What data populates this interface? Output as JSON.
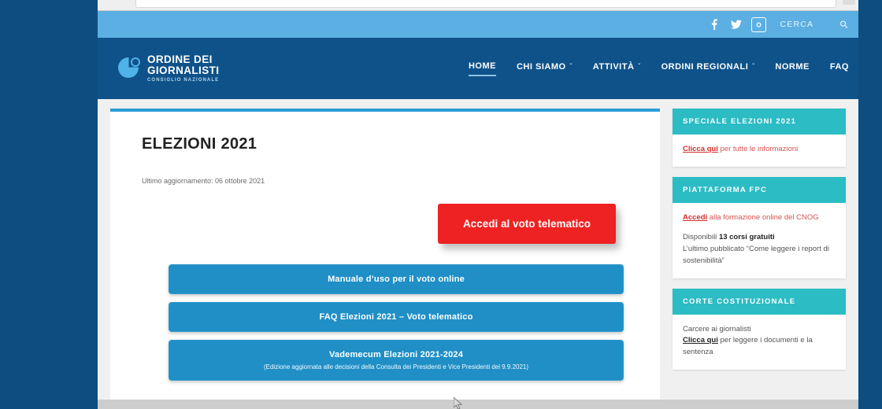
{
  "browser": {
    "urlbar_value": ""
  },
  "topbar": {
    "social": [
      {
        "name": "facebook-icon",
        "glyph": "f"
      },
      {
        "name": "twitter-icon",
        "glyph": "t"
      },
      {
        "name": "instagram-icon",
        "glyph": "▣"
      }
    ],
    "search_label": "CERCA",
    "search_icon": "search-icon"
  },
  "header": {
    "logo": {
      "line1": "ORDINE DEI",
      "line2": "GIORNALISTI",
      "line3": "CONSIGLIO NAZIONALE"
    },
    "menu": [
      {
        "label": "HOME",
        "caret": "",
        "active": true
      },
      {
        "label": "CHI SIAMO",
        "caret": "ˇ",
        "active": false
      },
      {
        "label": "ATTIVITÀ",
        "caret": "ˇ",
        "active": false
      },
      {
        "label": "ORDINI REGIONALI",
        "caret": "ˇ",
        "active": false
      },
      {
        "label": "NORME",
        "caret": "",
        "active": false
      },
      {
        "label": "FAQ",
        "caret": "",
        "active": false
      }
    ]
  },
  "article": {
    "title": "ELEZIONI 2021",
    "updated": "Ultimo aggiornamento: 06 ottobre 2021",
    "primary_button": "Accedi al voto telematico",
    "buttons": [
      {
        "title": "Manuale d’uso per il voto online",
        "subtitle": ""
      },
      {
        "title": "FAQ Elezioni 2021 – Voto telematico",
        "subtitle": ""
      },
      {
        "title": "Vademecum Elezioni 2021-2024",
        "subtitle": "(Edizione aggiornata alle decisioni della Consulta dei Presidenti e Vice Presidenti del 9.9.2021)"
      }
    ]
  },
  "sidebar": {
    "widgets": [
      {
        "heading": "SPECIALE ELEZIONI 2021",
        "link_text": "Clicca qui",
        "line_rest": " per tutte le informazioni"
      },
      {
        "heading": "PIATTAFORMA FPC",
        "link_text": "Accedi",
        "line_rest": " alla formazione online del CNOG",
        "stat_prefix": "Disponibili ",
        "stat_bold": "13 corsi gratuiti",
        "stat_suffix": "",
        "note": "L’ultimo pubblicato “Come leggere i report di sostenibilità”"
      },
      {
        "heading": "CORTE COSTITUZIONALE",
        "intro": "Carcere ai giornalisti",
        "link_text": "Clicca qui",
        "line_rest": " per leggere i documenti e la sentenza"
      }
    ]
  },
  "colors": {
    "page_background": "#0e4d80",
    "topbar": "#5bafe2",
    "navbar": "#0e5289",
    "accent_blue": "#2a9fd8",
    "button_blue": "#1f8fc6",
    "button_red": "#ee2222",
    "widget_teal": "#2bbcc4",
    "link_red": "#d62c2c"
  }
}
